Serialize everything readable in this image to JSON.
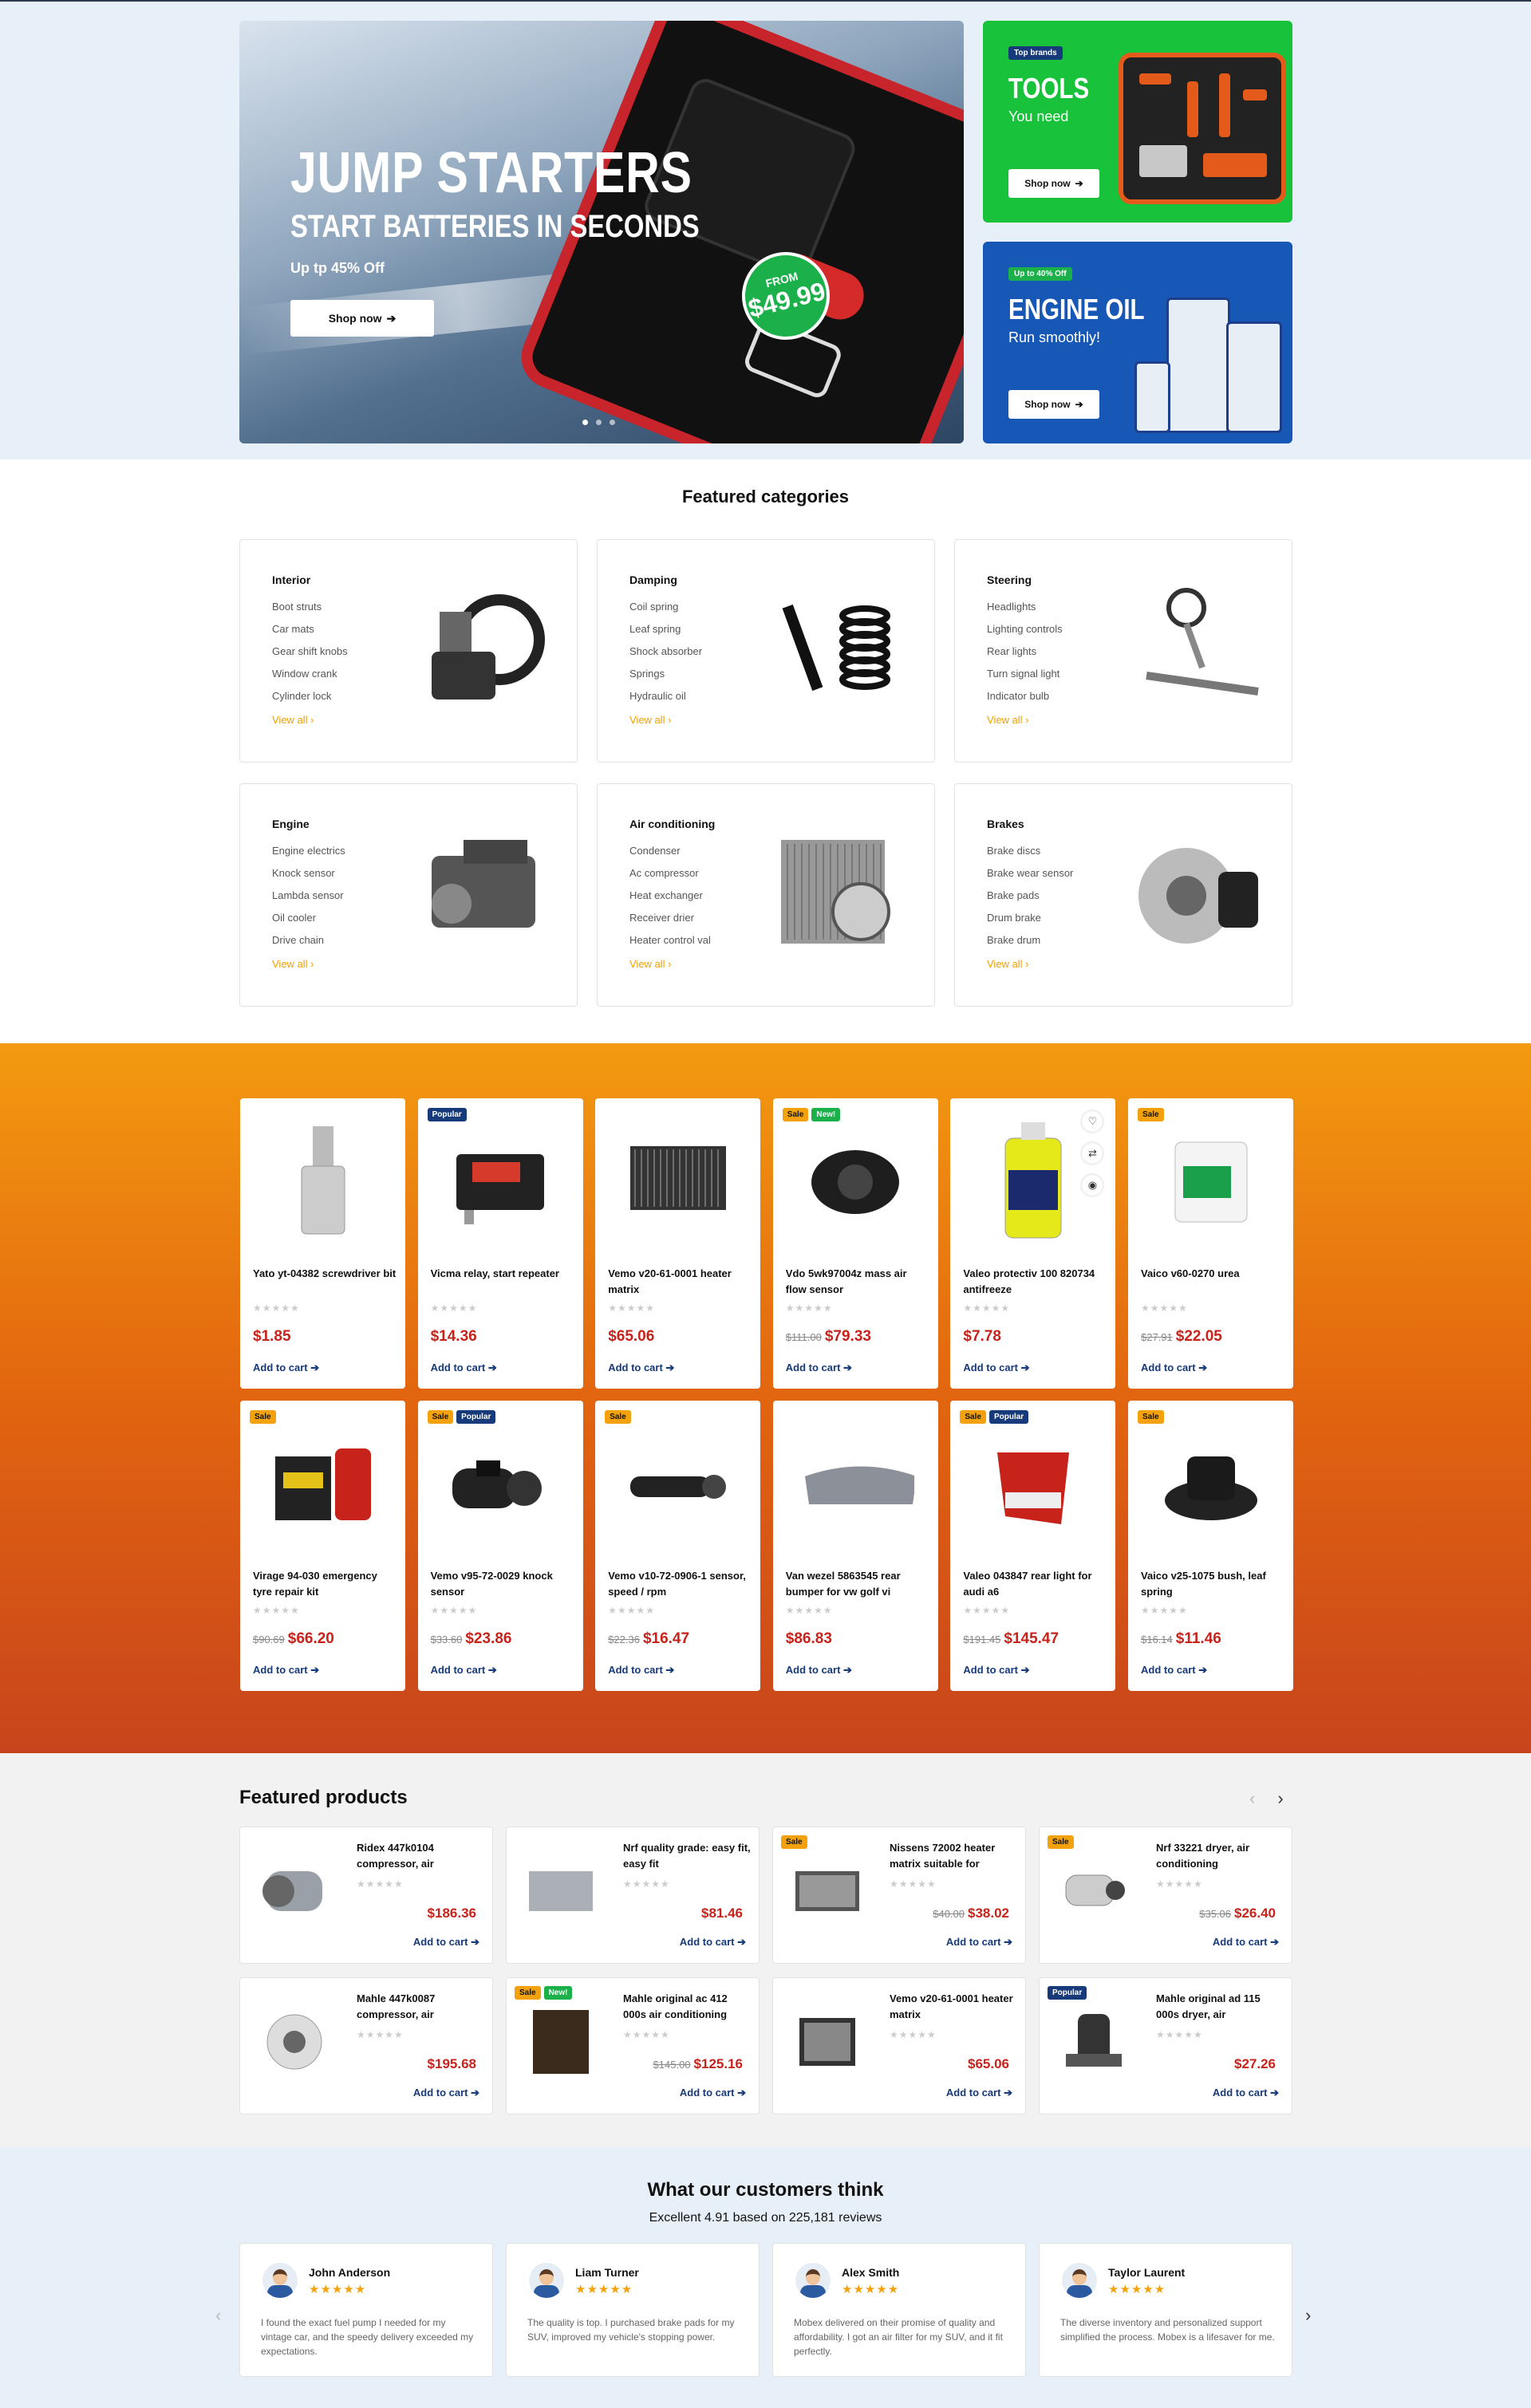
{
  "hero": {
    "main": {
      "title": "JUMP STARTERS",
      "subtitle": "START BATTERIES IN SECONDS",
      "offer": "Up tp 45% Off",
      "button": "Shop now",
      "badge_from": "FROM",
      "badge_price": "$49.99"
    },
    "tools": {
      "pill": "Top brands",
      "title": "TOOLS",
      "subtitle": "You need",
      "button": "Shop now"
    },
    "oil": {
      "pill": "Up to 40% Off",
      "title": "ENGINE OIL",
      "subtitle": "Run smoothly!",
      "button": "Shop now"
    },
    "colors": {
      "green": "#18c23a",
      "blue": "#1757b5",
      "badge_green": "#1bb04a"
    }
  },
  "categories": {
    "title": "Featured categories",
    "view_all": "View all",
    "items": [
      {
        "name": "Interior",
        "links": [
          "Boot struts",
          "Car mats",
          "Gear shift knobs",
          "Window crank",
          "Cylinder lock"
        ],
        "icon": "steering-wheel-icon"
      },
      {
        "name": "Damping",
        "links": [
          "Coil spring",
          "Leaf spring",
          "Shock absorber",
          "Springs",
          "Hydraulic oil"
        ],
        "icon": "shock-absorber-icon"
      },
      {
        "name": "Steering",
        "links": [
          "Headlights",
          "Lighting controls",
          "Rear lights",
          "Turn signal light",
          "Indicator bulb"
        ],
        "icon": "steering-rack-icon"
      },
      {
        "name": "Engine",
        "links": [
          "Engine electrics",
          "Knock sensor",
          "Lambda sensor",
          "Oil cooler",
          "Drive chain"
        ],
        "icon": "engine-icon"
      },
      {
        "name": "Air conditioning",
        "links": [
          "Condenser",
          "Ac compressor",
          "Heat exchanger",
          "Receiver drier",
          "Heater control val"
        ],
        "icon": "radiator-icon"
      },
      {
        "name": "Brakes",
        "links": [
          "Brake discs",
          "Brake wear sensor",
          "Brake pads",
          "Drum brake",
          "Brake drum"
        ],
        "icon": "brake-disc-icon"
      }
    ]
  },
  "products": {
    "add_to_cart": "Add to cart",
    "stars": "★★★★★",
    "badge_labels": {
      "sale": "Sale",
      "popular": "Popular",
      "new": "New!"
    },
    "items": [
      {
        "name": "Yato yt-04382 screwdriver bit",
        "price": "$1.85",
        "old": "",
        "badges": []
      },
      {
        "name": "Vicma relay, start repeater",
        "price": "$14.36",
        "old": "",
        "badges": [
          "popular"
        ]
      },
      {
        "name": "Vemo v20-61-0001 heater matrix",
        "price": "$65.06",
        "old": "",
        "badges": []
      },
      {
        "name": "Vdo 5wk97004z mass air flow sensor",
        "price": "$79.33",
        "old": "$111.00",
        "badges": [
          "sale",
          "new"
        ]
      },
      {
        "name": "Valeo protectiv 100 820734 antifreeze",
        "price": "$7.78",
        "old": "",
        "badges": []
      },
      {
        "name": "Vaico v60-0270 urea",
        "price": "$22.05",
        "old": "$27.91",
        "badges": [
          "sale"
        ]
      },
      {
        "name": "Virage 94-030 emergency tyre repair kit",
        "price": "$66.20",
        "old": "$90.69",
        "badges": [
          "sale"
        ]
      },
      {
        "name": "Vemo v95-72-0029 knock sensor",
        "price": "$23.86",
        "old": "$33.60",
        "badges": [
          "sale",
          "popular"
        ]
      },
      {
        "name": "Vemo v10-72-0906-1 sensor, speed / rpm",
        "price": "$16.47",
        "old": "$22.36",
        "badges": [
          "sale"
        ]
      },
      {
        "name": "Van wezel 5863545 rear bumper for vw golf vi",
        "price": "$86.83",
        "old": "",
        "badges": []
      },
      {
        "name": "Valeo 043847 rear light for audi a6",
        "price": "$145.47",
        "old": "$191.45",
        "badges": [
          "sale",
          "popular"
        ]
      },
      {
        "name": "Vaico v25-1075 bush, leaf spring",
        "price": "$11.46",
        "old": "$16.14",
        "badges": [
          "sale"
        ]
      }
    ]
  },
  "featured": {
    "title": "Featured products",
    "prev": "‹",
    "next": "›",
    "items": [
      {
        "name": "Ridex 447k0104 compressor, air",
        "price": "$186.36",
        "old": "",
        "badges": []
      },
      {
        "name": "Nrf quality grade: easy fit, easy fit",
        "price": "$81.46",
        "old": "",
        "badges": []
      },
      {
        "name": "Nissens 72002 heater matrix suitable for",
        "price": "$38.02",
        "old": "$40.00",
        "badges": [
          "sale"
        ]
      },
      {
        "name": "Nrf 33221 dryer, air conditioning",
        "price": "$26.40",
        "old": "$35.06",
        "badges": [
          "sale"
        ]
      },
      {
        "name": "Mahle 447k0087 compressor, air",
        "price": "$195.68",
        "old": "",
        "badges": []
      },
      {
        "name": "Mahle original ac 412 000s air conditioning",
        "price": "$125.16",
        "old": "$145.00",
        "badges": [
          "sale",
          "new"
        ]
      },
      {
        "name": "Vemo v20-61-0001 heater matrix",
        "price": "$65.06",
        "old": "",
        "badges": []
      },
      {
        "name": "Mahle original ad 115 000s dryer, air",
        "price": "$27.26",
        "old": "",
        "badges": [
          "popular"
        ]
      }
    ]
  },
  "reviews": {
    "title": "What our customers think",
    "subtitle": "Excellent 4.91 based on 225,181 reviews",
    "prev": "‹",
    "next": "›",
    "stars": "★★★★★",
    "items": [
      {
        "name": "John Anderson",
        "text": "I found the exact fuel pump I needed for my vintage car, and the speedy delivery exceeded my expectations."
      },
      {
        "name": "Liam Turner",
        "text": "The quality is top. I purchased brake pads for my SUV, improved my vehicle's stopping power."
      },
      {
        "name": "Alex Smith",
        "text": "Mobex delivered on their promise of quality and affordability. I got an air filter for my SUV, and it fit perfectly."
      },
      {
        "name": "Taylor Laurent",
        "text": "The diverse inventory and personalized support simplified the process. Mobex is a lifesaver for me."
      }
    ]
  }
}
